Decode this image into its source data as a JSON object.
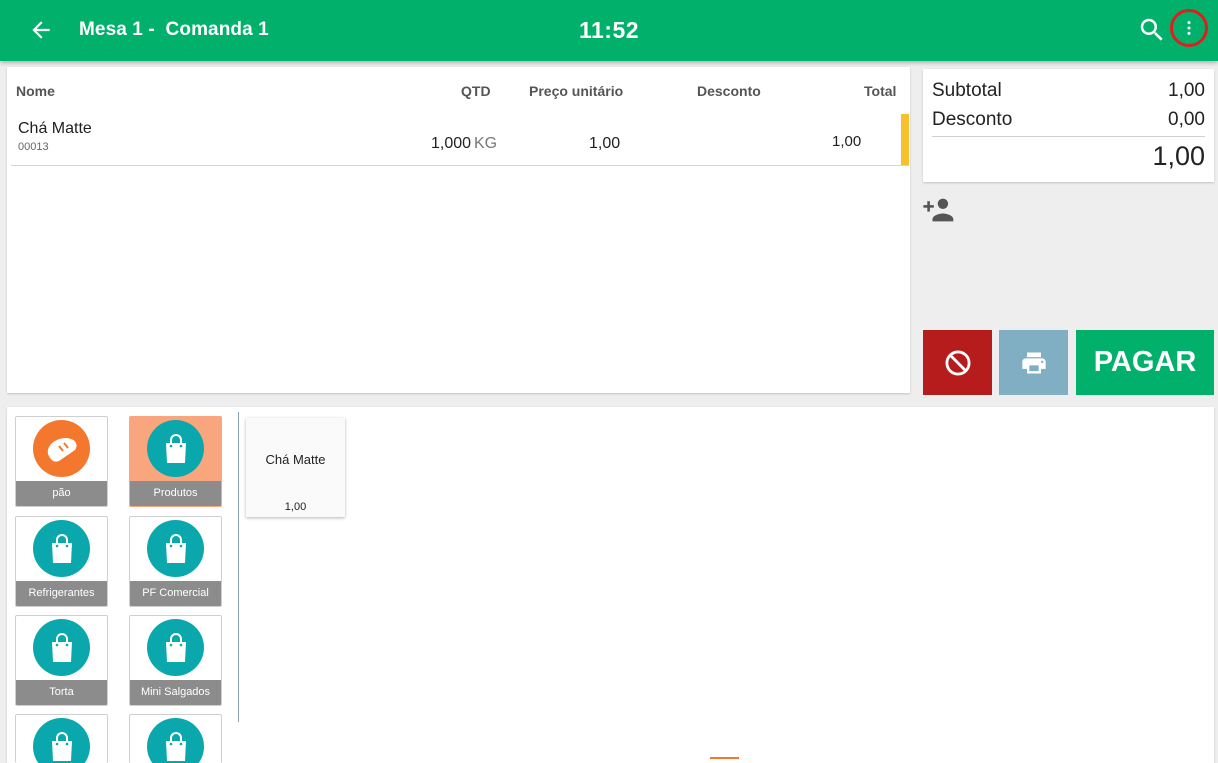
{
  "header": {
    "title": "Mesa 1 -  Comanda 1",
    "clock": "11:52",
    "back_icon": "arrow-back-icon",
    "search_icon": "search-icon",
    "menu_icon": "more-vert-icon"
  },
  "order": {
    "columns": {
      "name": "Nome",
      "qty": "QTD",
      "unit_price": "Preço unitário",
      "discount": "Desconto",
      "total": "Total"
    },
    "items": [
      {
        "name": "Chá Matte",
        "code": "00013",
        "qty": "1,000",
        "unit": "KG",
        "unit_price": "1,00",
        "discount": "",
        "total": "1,00"
      }
    ]
  },
  "summary": {
    "subtotal_label": "Subtotal",
    "subtotal_value": "1,00",
    "discount_label": "Desconto",
    "discount_value": "0,00",
    "total": "1,00"
  },
  "actions": {
    "add_customer_icon": "person-add-icon",
    "cancel_icon": "block-icon",
    "print_icon": "print-icon",
    "pay_label": "PAGAR"
  },
  "categories": [
    {
      "label": "pão",
      "icon": "bread-icon"
    },
    {
      "label": "Produtos",
      "icon": "shopping-bag-icon",
      "selected": true
    },
    {
      "label": "Refrigerantes",
      "icon": "shopping-bag-icon"
    },
    {
      "label": "PF Comercial",
      "icon": "shopping-bag-icon"
    },
    {
      "label": "Torta",
      "icon": "shopping-bag-icon"
    },
    {
      "label": "Mini Salgados",
      "icon": "shopping-bag-icon"
    },
    {
      "label": "",
      "icon": "shopping-bag-icon"
    },
    {
      "label": "",
      "icon": "shopping-bag-icon"
    }
  ],
  "products": [
    {
      "name": "Chá Matte",
      "price": "1,00"
    }
  ],
  "colors": {
    "primary": "#00b06b",
    "cancel": "#b71c1c",
    "print": "#80aec2",
    "category_circle": "#0aa8ad",
    "bread_circle": "#f3782d",
    "selected_category": "#f9a57e",
    "row_marker": "#f7c12b"
  }
}
